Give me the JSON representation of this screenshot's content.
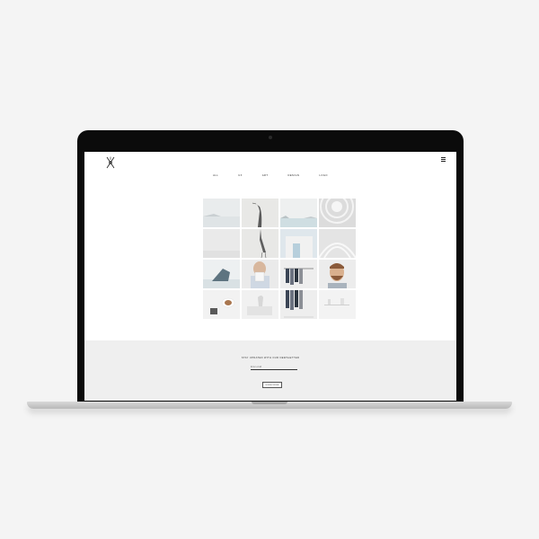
{
  "site": {
    "nav": [
      "All",
      "UX",
      "Art",
      "Design",
      "Logo"
    ]
  },
  "gallery": {
    "tiles": [
      "sea-cliff",
      "heron",
      "bay-view",
      "spiral-ceiling",
      "white-wall",
      "heron-lower",
      "white-room",
      "atrium",
      "blue-rock",
      "man-with-paper",
      "clothes-rack",
      "bearded-man",
      "coffee-cup",
      "tray-vase",
      "clothes-rack-lower",
      "white-shelf"
    ]
  },
  "newsletter": {
    "title": "Stay updated with our newsletter",
    "email_placeholder": "Enter email",
    "subscribe_label": "Subscribe"
  },
  "colors": {
    "page_background": "#f4f4f4",
    "laptop_bezel": "#0b0b0b",
    "footer_background": "#efefef",
    "text": "#222222"
  }
}
